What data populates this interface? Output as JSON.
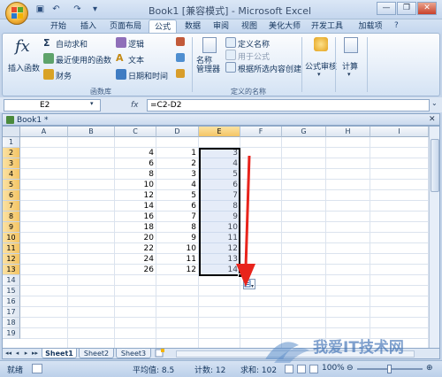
{
  "window": {
    "title": "Book1 [兼容模式] - Microsoft Excel",
    "minimize_glyph": "—",
    "restore_glyph": "❐",
    "close_glyph": "✕"
  },
  "qat": [
    "save-icon",
    "undo-icon",
    "redo-icon",
    "customize-icon"
  ],
  "tabs": [
    "开始",
    "插入",
    "页面布局",
    "公式",
    "数据",
    "审阅",
    "视图",
    "美化大师",
    "开发工具",
    "加载项"
  ],
  "active_tab": "公式",
  "ribbon": {
    "insert_function": "插入函数",
    "autosum": "自动求和",
    "recent": "最近使用的函数",
    "financial": "财务",
    "logical": "逻辑",
    "text": "文本",
    "datetime": "日期和时间",
    "name_manager": "名称\n管理器",
    "define_name": "定义名称",
    "use_in_formula": "用于公式",
    "create_from_selection": "根据所选内容创建",
    "formula_auditing": "公式审核",
    "calculation": "计算",
    "group_library": "函数库",
    "group_defined_names": "定义的名称"
  },
  "formula_bar": {
    "name_box": "E2",
    "fx": "fx",
    "formula": "=C2-D2"
  },
  "workbook": {
    "tab_label": "Book1 *"
  },
  "columns": [
    "A",
    "B",
    "C",
    "D",
    "E",
    "F",
    "G",
    "H",
    "I"
  ],
  "rows": [
    "1",
    "2",
    "3",
    "4",
    "5",
    "6",
    "7",
    "8",
    "9",
    "10",
    "11",
    "12",
    "13",
    "14",
    "15",
    "16",
    "17",
    "18",
    "19"
  ],
  "data": {
    "C": [
      "4",
      "6",
      "8",
      "10",
      "12",
      "14",
      "16",
      "18",
      "20",
      "22",
      "24",
      "26"
    ],
    "D": [
      "1",
      "2",
      "3",
      "4",
      "5",
      "6",
      "7",
      "8",
      "9",
      "10",
      "11",
      "12"
    ],
    "E": [
      "3",
      "4",
      "5",
      "6",
      "7",
      "8",
      "9",
      "10",
      "11",
      "12",
      "13",
      "14"
    ]
  },
  "sheets": [
    "Sheet1",
    "Sheet2",
    "Sheet3"
  ],
  "status": {
    "mode": "就绪",
    "average": "平均值: 8.5",
    "count": "计数: 12",
    "sum": "求和: 102",
    "zoom": "100%"
  },
  "watermark": "我爱IT技术网"
}
